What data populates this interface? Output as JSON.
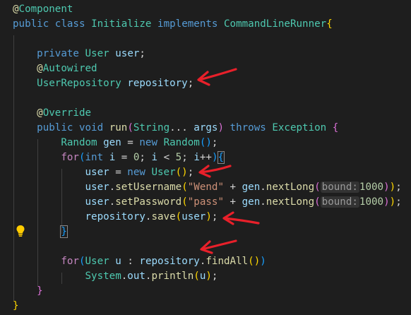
{
  "code": {
    "lines": [
      {
        "tokens": [
          {
            "t": "@",
            "c": "ann"
          },
          {
            "t": "Component",
            "c": "type"
          }
        ]
      },
      {
        "tokens": [
          {
            "t": "public",
            "c": "kw"
          },
          {
            "t": " ",
            "c": "plain"
          },
          {
            "t": "class",
            "c": "kw"
          },
          {
            "t": " ",
            "c": "plain"
          },
          {
            "t": "Initialize",
            "c": "type"
          },
          {
            "t": " ",
            "c": "plain"
          },
          {
            "t": "implements",
            "c": "kw"
          },
          {
            "t": " ",
            "c": "plain"
          },
          {
            "t": "CommandLineRunner",
            "c": "type"
          },
          {
            "t": "{",
            "c": "br1"
          }
        ]
      },
      {
        "tokens": []
      },
      {
        "tokens": [
          {
            "t": "    ",
            "c": "plain"
          },
          {
            "t": "private",
            "c": "kw"
          },
          {
            "t": " ",
            "c": "plain"
          },
          {
            "t": "User",
            "c": "type"
          },
          {
            "t": " ",
            "c": "plain"
          },
          {
            "t": "user",
            "c": "var"
          },
          {
            "t": ";",
            "c": "plain"
          }
        ]
      },
      {
        "tokens": [
          {
            "t": "    ",
            "c": "plain"
          },
          {
            "t": "@",
            "c": "ann"
          },
          {
            "t": "Autowired",
            "c": "type"
          }
        ]
      },
      {
        "tokens": [
          {
            "t": "    ",
            "c": "plain"
          },
          {
            "t": "UserRepository",
            "c": "type"
          },
          {
            "t": " ",
            "c": "plain"
          },
          {
            "t": "repository",
            "c": "var"
          },
          {
            "t": ";",
            "c": "plain"
          }
        ]
      },
      {
        "tokens": []
      },
      {
        "tokens": [
          {
            "t": "    ",
            "c": "plain"
          },
          {
            "t": "@",
            "c": "ann"
          },
          {
            "t": "Override",
            "c": "type"
          }
        ]
      },
      {
        "tokens": [
          {
            "t": "    ",
            "c": "plain"
          },
          {
            "t": "public",
            "c": "kw"
          },
          {
            "t": " ",
            "c": "plain"
          },
          {
            "t": "void",
            "c": "kw"
          },
          {
            "t": " ",
            "c": "plain"
          },
          {
            "t": "run",
            "c": "fn"
          },
          {
            "t": "(",
            "c": "br2"
          },
          {
            "t": "String",
            "c": "type"
          },
          {
            "t": "... ",
            "c": "plain"
          },
          {
            "t": "args",
            "c": "var"
          },
          {
            "t": ")",
            "c": "br2"
          },
          {
            "t": " ",
            "c": "plain"
          },
          {
            "t": "throws",
            "c": "kw"
          },
          {
            "t": " ",
            "c": "plain"
          },
          {
            "t": "Exception",
            "c": "type"
          },
          {
            "t": " ",
            "c": "plain"
          },
          {
            "t": "{",
            "c": "br2"
          }
        ]
      },
      {
        "tokens": [
          {
            "t": "        ",
            "c": "plain"
          },
          {
            "t": "Random",
            "c": "type"
          },
          {
            "t": " ",
            "c": "plain"
          },
          {
            "t": "gen",
            "c": "var"
          },
          {
            "t": " = ",
            "c": "plain"
          },
          {
            "t": "new",
            "c": "kw"
          },
          {
            "t": " ",
            "c": "plain"
          },
          {
            "t": "Random",
            "c": "type"
          },
          {
            "t": "()",
            "c": "br3"
          },
          {
            "t": ";",
            "c": "plain"
          }
        ]
      },
      {
        "tokens": [
          {
            "t": "        ",
            "c": "plain"
          },
          {
            "t": "for",
            "c": "ctrl"
          },
          {
            "t": "(",
            "c": "br3"
          },
          {
            "t": "int",
            "c": "kw"
          },
          {
            "t": " ",
            "c": "plain"
          },
          {
            "t": "i",
            "c": "var"
          },
          {
            "t": " = ",
            "c": "plain"
          },
          {
            "t": "0",
            "c": "num"
          },
          {
            "t": "; ",
            "c": "plain"
          },
          {
            "t": "i",
            "c": "var"
          },
          {
            "t": " < ",
            "c": "plain"
          },
          {
            "t": "5",
            "c": "num"
          },
          {
            "t": "; ",
            "c": "plain"
          },
          {
            "t": "i",
            "c": "var"
          },
          {
            "t": "++",
            "c": "plain"
          },
          {
            "t": ")",
            "c": "br3"
          },
          {
            "t": "{",
            "c": "br3",
            "h": true
          }
        ]
      },
      {
        "tokens": [
          {
            "t": "            ",
            "c": "plain"
          },
          {
            "t": "user",
            "c": "var"
          },
          {
            "t": " = ",
            "c": "plain"
          },
          {
            "t": "new",
            "c": "kw"
          },
          {
            "t": " ",
            "c": "plain"
          },
          {
            "t": "User",
            "c": "type"
          },
          {
            "t": "()",
            "c": "br1"
          },
          {
            "t": ";",
            "c": "plain"
          }
        ]
      },
      {
        "tokens": [
          {
            "t": "            ",
            "c": "plain"
          },
          {
            "t": "user",
            "c": "var"
          },
          {
            "t": ".",
            "c": "plain"
          },
          {
            "t": "setUsername",
            "c": "fn"
          },
          {
            "t": "(",
            "c": "br1"
          },
          {
            "t": "\"Wend\"",
            "c": "str"
          },
          {
            "t": " + ",
            "c": "plain"
          },
          {
            "t": "gen",
            "c": "var"
          },
          {
            "t": ".",
            "c": "plain"
          },
          {
            "t": "nextLong",
            "c": "fn"
          },
          {
            "t": "(",
            "c": "br2"
          },
          {
            "t": "bound:",
            "c": "hint"
          },
          {
            "t": "1000",
            "c": "num"
          },
          {
            "t": ")",
            "c": "br2"
          },
          {
            "t": ")",
            "c": "br1"
          },
          {
            "t": ";",
            "c": "plain"
          }
        ]
      },
      {
        "tokens": [
          {
            "t": "            ",
            "c": "plain"
          },
          {
            "t": "user",
            "c": "var"
          },
          {
            "t": ".",
            "c": "plain"
          },
          {
            "t": "setPassword",
            "c": "fn"
          },
          {
            "t": "(",
            "c": "br1"
          },
          {
            "t": "\"pass\"",
            "c": "str"
          },
          {
            "t": " + ",
            "c": "plain"
          },
          {
            "t": "gen",
            "c": "var"
          },
          {
            "t": ".",
            "c": "plain"
          },
          {
            "t": "nextLong",
            "c": "fn"
          },
          {
            "t": "(",
            "c": "br2"
          },
          {
            "t": "bound:",
            "c": "hint"
          },
          {
            "t": "1000",
            "c": "num"
          },
          {
            "t": ")",
            "c": "br2"
          },
          {
            "t": ")",
            "c": "br1"
          },
          {
            "t": ";",
            "c": "plain"
          }
        ]
      },
      {
        "tokens": [
          {
            "t": "            ",
            "c": "plain"
          },
          {
            "t": "repository",
            "c": "var"
          },
          {
            "t": ".",
            "c": "plain"
          },
          {
            "t": "save",
            "c": "fn"
          },
          {
            "t": "(",
            "c": "br1"
          },
          {
            "t": "user",
            "c": "var"
          },
          {
            "t": ")",
            "c": "br1"
          },
          {
            "t": ";",
            "c": "plain"
          }
        ]
      },
      {
        "tokens": [
          {
            "t": "        ",
            "c": "plain"
          },
          {
            "t": "}",
            "c": "br3",
            "h": true
          }
        ]
      },
      {
        "tokens": []
      },
      {
        "tokens": [
          {
            "t": "        ",
            "c": "plain"
          },
          {
            "t": "for",
            "c": "ctrl"
          },
          {
            "t": "(",
            "c": "br3"
          },
          {
            "t": "User",
            "c": "type"
          },
          {
            "t": " ",
            "c": "plain"
          },
          {
            "t": "u",
            "c": "var"
          },
          {
            "t": " : ",
            "c": "plain"
          },
          {
            "t": "repository",
            "c": "var"
          },
          {
            "t": ".",
            "c": "plain"
          },
          {
            "t": "findAll",
            "c": "fn"
          },
          {
            "t": "()",
            "c": "br1"
          },
          {
            "t": ")",
            "c": "br3"
          }
        ]
      },
      {
        "tokens": [
          {
            "t": "            ",
            "c": "plain"
          },
          {
            "t": "System",
            "c": "type"
          },
          {
            "t": ".",
            "c": "plain"
          },
          {
            "t": "out",
            "c": "var"
          },
          {
            "t": ".",
            "c": "plain"
          },
          {
            "t": "println",
            "c": "fn"
          },
          {
            "t": "(",
            "c": "br1"
          },
          {
            "t": "u",
            "c": "var"
          },
          {
            "t": ")",
            "c": "br1"
          },
          {
            "t": ";",
            "c": "plain"
          }
        ]
      },
      {
        "tokens": [
          {
            "t": "    ",
            "c": "plain"
          },
          {
            "t": "}",
            "c": "br2"
          }
        ]
      },
      {
        "tokens": [
          {
            "t": "}",
            "c": "br1"
          }
        ]
      }
    ]
  },
  "lightbulb_icon": "lightbulb-icon",
  "annotation_color": "#e8202a"
}
